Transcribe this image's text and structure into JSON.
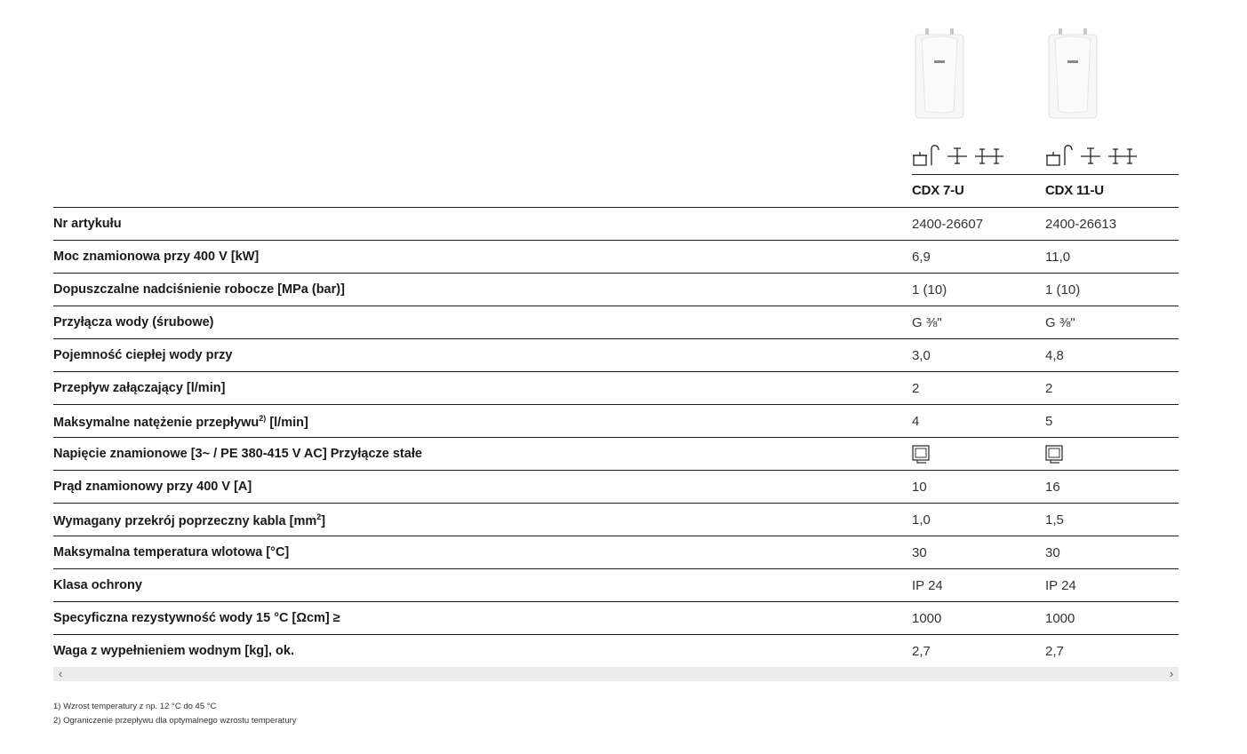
{
  "products": [
    {
      "model": "CDX 7-U",
      "image": "water-heater-image",
      "usage_icons": [
        "kitchen-pot-icon",
        "single-tap-icon",
        "double-tap-icon"
      ]
    },
    {
      "model": "CDX 11-U",
      "image": "water-heater-image",
      "usage_icons": [
        "kitchen-pot-icon",
        "single-tap-icon",
        "double-tap-icon"
      ]
    }
  ],
  "rows": [
    {
      "label": "Nr artykułu",
      "values": [
        "2400-26607",
        "2400-26613"
      ]
    },
    {
      "label": "Moc znamionowa przy 400 V [kW]",
      "values": [
        "6,9",
        "11,0"
      ]
    },
    {
      "label": "Dopuszczalne nadciśnienie robocze [MPa (bar)]",
      "values": [
        "1 (10)",
        "1 (10)"
      ]
    },
    {
      "label": "Przyłącza wody (śrubowe)",
      "values": [
        "G ⅜\"",
        "G ⅜\""
      ]
    },
    {
      "label": "Pojemność ciepłej wody przy",
      "values": [
        "3,0",
        "4,8"
      ]
    },
    {
      "label": "Przepływ załączający [l/min]",
      "values": [
        "2",
        "2"
      ]
    },
    {
      "label_pre": "Maksymalne natężenie przepływu",
      "label_sup": "2)",
      "label_post": "[l/min]",
      "values": [
        "4",
        "5"
      ]
    },
    {
      "label": "Napięcie znamionowe [3~ / PE 380-415 V AC] Przyłącze stałe",
      "values_icon": "fixed-connection-icon"
    },
    {
      "label": "Prąd znamionowy przy 400 V [A]",
      "values": [
        "10",
        "16"
      ]
    },
    {
      "label_pre": "Wymagany przekrój poprzeczny kabla [mm",
      "label_sup": "2",
      "label_post": "]",
      "values": [
        "1,0",
        "1,5"
      ]
    },
    {
      "label": "Maksymalna temperatura wlotowa [°C]",
      "values": [
        "30",
        "30"
      ]
    },
    {
      "label": "Klasa ochrony",
      "values": [
        "IP 24",
        "IP 24"
      ]
    },
    {
      "label": "Specyficzna rezystywność wody 15 °C [Ωcm] ≥",
      "values": [
        "1000",
        "1000"
      ]
    },
    {
      "label": "Waga z wypełnieniem wodnym [kg], ok.",
      "values": [
        "2,7",
        "2,7"
      ]
    }
  ],
  "scrollbar": {
    "left_arrow": "‹",
    "right_arrow": "›"
  },
  "footnotes": [
    "1) Wzrost temperatury z np. 12 °C do 45 °C",
    "2) Ograniczenie przepływu dla optymalnego wzrostu temperatury"
  ]
}
